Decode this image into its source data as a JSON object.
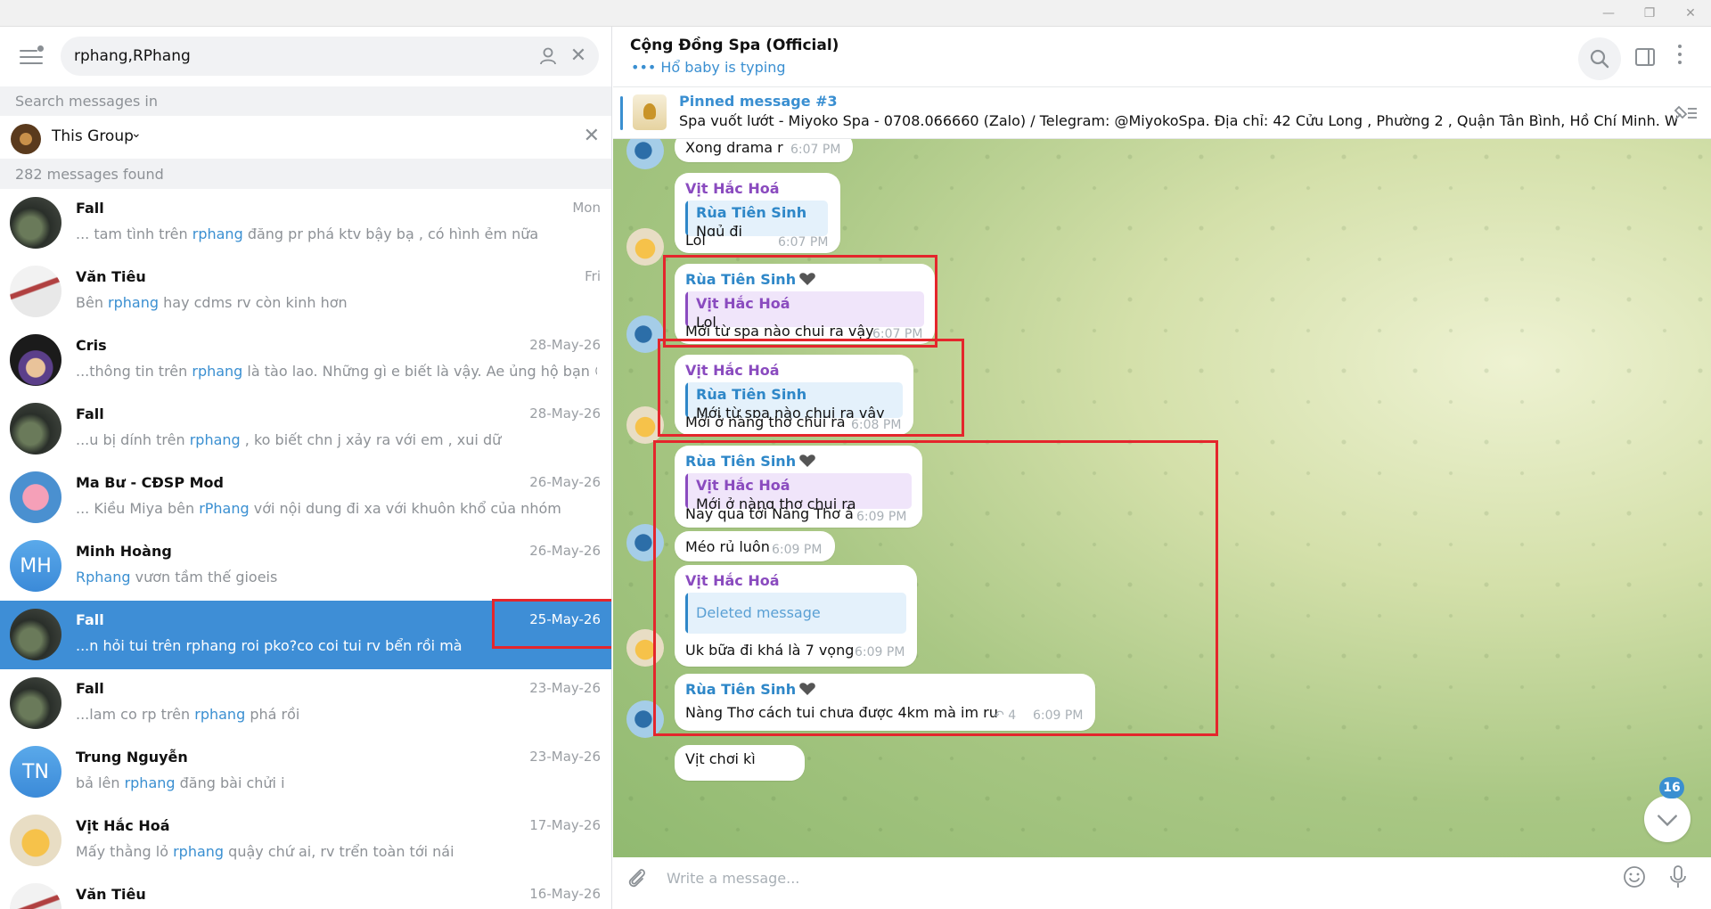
{
  "colors": {
    "accent": "#3a8fd1",
    "selected": "#3e8ed6",
    "highlight_box": "#e4262c",
    "purple_sender": "#8a4bbf",
    "blue_sender": "#2e87c8"
  },
  "window": {
    "minimize": "—",
    "restore": "❐",
    "close": "✕"
  },
  "search": {
    "query": "rphang,RPhang",
    "clear": "✕"
  },
  "filter": {
    "search_in_label": "Search messages in",
    "group_label": "This Group",
    "group_chevron": "⌄",
    "close": "✕",
    "found": "282 messages found"
  },
  "results": [
    {
      "name": "Fall",
      "date": "Mon",
      "pre": "... tam tình trên ",
      "hl": "rphang",
      "post": " đăng pr phá ktv bậy bạ , có hình ẻm nữa"
    },
    {
      "name": "Văn Tiêu",
      "date": "Fri",
      "pre": "Bên ",
      "hl": "rphang",
      "post": " hay cdms rv còn kinh hơn"
    },
    {
      "name": "Cris",
      "date": "28-May-26",
      "pre": "...thông tin trên ",
      "hl": "rphang",
      "post": " là tào lao. Những gì e biết là vậy. Ae ủng hộ bạn 😘..."
    },
    {
      "name": "Fall",
      "date": "28-May-26",
      "pre": "...u bị dính trên ",
      "hl": "rphang",
      "post": " , ko biết chn j xảy ra với em , xui dữ"
    },
    {
      "name": "Ma Bư - CĐSP Mod",
      "date": "26-May-26",
      "pre": "... Kiều Miya bên ",
      "hl": "rPhang",
      "post": " với nội dung đi xa với khuôn khổ của nhóm"
    },
    {
      "name": "Minh Hoàng",
      "date": "26-May-26",
      "pre": "",
      "hl": "Rphang",
      "post": " vươn tầm thế gioeis",
      "initials": "MH"
    },
    {
      "name": "Fall",
      "date": "25-May-26",
      "pre": "...n hỏi tui trên ",
      "hl": "rphang",
      "post": " roi pko?co coi tui rv bển rồi mà"
    },
    {
      "name": "Fall",
      "date": "23-May-26",
      "pre": "...lam co rp trên ",
      "hl": "rphang",
      "post": " phá rồi"
    },
    {
      "name": "Trung Nguyễn",
      "date": "23-May-26",
      "pre": "bả lên ",
      "hl": "rphang",
      "post": " đăng bài chửi i",
      "initials": "TN"
    },
    {
      "name": "Vịt Hắc Hoá",
      "date": "17-May-26",
      "pre": "Mấy thằng lỏ ",
      "hl": "rphang",
      "post": " quậy chứ ai, rv trển toàn tới nái"
    },
    {
      "name": "Văn Tiêu",
      "date": "16-May-26",
      "pre": "",
      "hl": "",
      "post": ""
    }
  ],
  "chat": {
    "title": "Cộng Đồng Spa (Official)",
    "status_dots": "•••",
    "status": " Hổ baby is typing",
    "pinned_title": "Pinned message #3",
    "pinned_text": "Spa vuốt lướt  - Miyoko Spa - 0708.066660 (Zalo) / Telegram: @MiyokoSpa.  Địa chỉ: 42 Cửu Long , Phường 2 , Quận Tân Bình, Hồ Chí Minh. Websi...",
    "unread_count": "16",
    "compose_placeholder": "Write a message..."
  },
  "messages": {
    "m1": {
      "text": "Xong drama r",
      "time": "6:07 PM"
    },
    "m2": {
      "sender": "Vịt Hắc Hoá",
      "quote_name": "Rùa Tiên Sinh",
      "quote_text": "Ngủ đi",
      "text": "Lol",
      "time": "6:07 PM"
    },
    "m3": {
      "sender": "Rùa Tiên Sinh",
      "quote_name": "Vịt Hắc Hoá",
      "quote_text": "Lol",
      "text": "Mới từ spa nào chui ra vậy",
      "time": "6:07 PM"
    },
    "m4": {
      "sender": "Vịt Hắc Hoá",
      "quote_name": "Rùa Tiên Sinh",
      "quote_text": "Mới từ spa nào chui ra vậy",
      "text": "Mới ở nàng thơ chui ra",
      "time": "6:08 PM"
    },
    "m5": {
      "sender": "Rùa Tiên Sinh",
      "quote_name": "Vịt Hắc Hoá",
      "quote_text": "Mới ở nàng thơ chui ra",
      "text": "Nay qua tới Nàng Thơ à",
      "time": "6:09 PM"
    },
    "m6": {
      "text": "Méo rủ luôn",
      "time": "6:09 PM"
    },
    "m7": {
      "sender": "Vịt Hắc Hoá",
      "quote_deleted": "Deleted message",
      "text": "Uk bữa đi khá là 7 vọng",
      "time": "6:09 PM"
    },
    "m8": {
      "sender": "Rùa Tiên Sinh",
      "text": "Nàng Thơ cách tui chưa được 4km mà im ru",
      "replies": "4",
      "time": "6:09 PM"
    },
    "m9": {
      "text": "Vịt chơi kì"
    }
  }
}
